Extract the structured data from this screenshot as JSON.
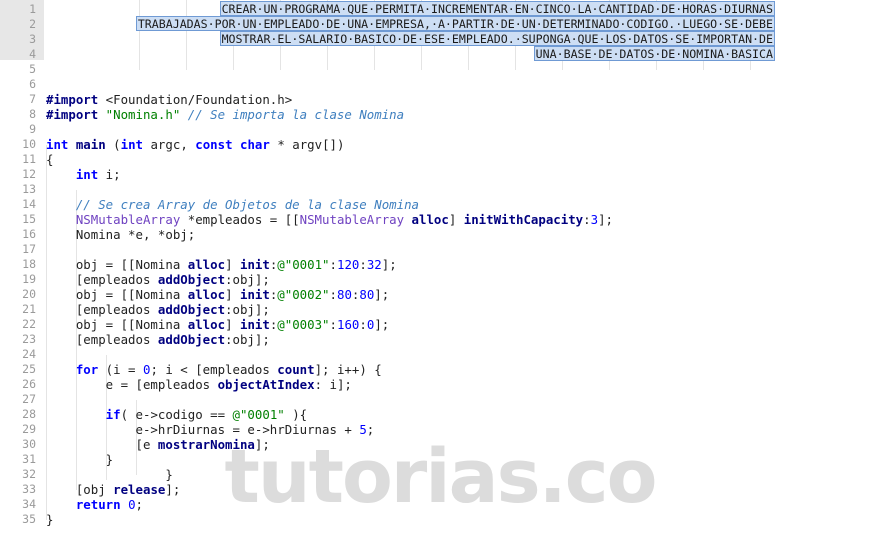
{
  "editor": {
    "language": "Objective-C",
    "watermark": "tutorias.co",
    "gutter_highlight_lines": [
      1,
      2,
      3,
      4
    ],
    "total_lines": 35,
    "colors": {
      "background": "#ffffff",
      "gutter_background": "#e7e7e7",
      "line_number": "#9a9a9a",
      "selection_fill": "#cddef4",
      "selection_border": "#6f9ad4",
      "keyword": "#0000ff",
      "preprocessor": "#000080",
      "string": "#008000",
      "comment": "#3f7fbf",
      "class_name": "#6f42c1",
      "selector": "#000080",
      "number": "#0000ff",
      "watermark": "#dcdcdc",
      "indent_guide": "#e4e4e4"
    }
  },
  "line_numbers": [
    "1",
    "2",
    "3",
    "4",
    "5",
    "6",
    "7",
    "8",
    "9",
    "10",
    "11",
    "12",
    "13",
    "14",
    "15",
    "16",
    "17",
    "18",
    "19",
    "20",
    "21",
    "22",
    "23",
    "24",
    "25",
    "26",
    "27",
    "28",
    "29",
    "30",
    "31",
    "32",
    "33",
    "34",
    "35"
  ],
  "selected_header": {
    "full_text": "CREAR UN PROGRAMA QUE PERMITA INCREMENTAR EN CINCO LA CANTIDAD DE HORAS DIURNAS TRABAJADAS POR UN EMPLEADO DE UNA EMPRESA, A PARTIR DE UN DETERMINADO CODIGO. LUEGO SE DEBE MOSTRAR EL SALARIO BASICO DE ESE EMPLEADO. SUPONGA QUE LOS DATOS SE IMPORTAN DE UNA BASE DE DATOS DE NOMINA BASICA",
    "lines": [
      "CREAR·UN·PROGRAMA·QUE·PERMITA·INCREMENTAR·EN·CINCO·LA·CANTIDAD·DE·HORAS·DIURNAS",
      "TRABAJADAS·POR·UN·EMPLEADO·DE·UNA·EMPRESA,·A·PARTIR·DE·UN·DETERMINADO·CODIGO.·LUEGO·SE·DEBE",
      "MOSTRAR·EL·SALARIO·BASICO·DE·ESE·EMPLEADO.·SUPONGA·QUE·LOS·DATOS·SE·IMPORTAN·DE",
      "UNA·BASE·DE·DATOS·DE·NOMINA·BASICA"
    ]
  },
  "code_lines": {
    "l7": {
      "pre": "#import",
      "rest": " <Foundation/Foundation.h>"
    },
    "l8": {
      "pre": "#import",
      "str": " \"Nomina.h\"",
      "cmt": " // Se importa la clase Nomina"
    },
    "l10": {
      "kw1": "int",
      "fn": " main",
      "p1": " (",
      "kw2": "int",
      "p2": " argc, ",
      "kw3": "const",
      "kw4": " char",
      "p3": " * argv[])"
    },
    "l11": {
      "text": "{"
    },
    "l12": {
      "kw": "    int",
      "text": " i;"
    },
    "l14": {
      "cmt": "    // Se crea Array de Objetos de la clase Nomina"
    },
    "l15": {
      "cls": "    NSMutableArray",
      "p1": " *empleados = [[",
      "cls2": "NSMutableArray",
      "sel1": " alloc",
      "p2": "] ",
      "sel2": "initWithCapacity",
      "p3": ":",
      "num": "3",
      "p4": "];"
    },
    "l16": {
      "text": "    Nomina *e, *obj;"
    },
    "l18": {
      "p1": "    obj = [[Nomina ",
      "sel1": "alloc",
      "p2": "] ",
      "sel2": "init",
      "p3": ":",
      "str": "@\"0001\"",
      "p4": ":",
      "num1": "120",
      "p5": ":",
      "num2": "32",
      "p6": "];"
    },
    "l19": {
      "p1": "    [empleados ",
      "sel": "addObject",
      "p2": ":obj];"
    },
    "l20": {
      "p1": "    obj = [[Nomina ",
      "sel1": "alloc",
      "p2": "] ",
      "sel2": "init",
      "p3": ":",
      "str": "@\"0002\"",
      "p4": ":",
      "num1": "80",
      "p5": ":",
      "num2": "80",
      "p6": "];"
    },
    "l21": {
      "p1": "    [empleados ",
      "sel": "addObject",
      "p2": ":obj];"
    },
    "l22": {
      "p1": "    obj = [[Nomina ",
      "sel1": "alloc",
      "p2": "] ",
      "sel2": "init",
      "p3": ":",
      "str": "@\"0003\"",
      "p4": ":",
      "num1": "160",
      "p5": ":",
      "num2": "0",
      "p6": "];"
    },
    "l23": {
      "p1": "    [empleados ",
      "sel": "addObject",
      "p2": ":obj];"
    },
    "l25": {
      "kw": "    for",
      "p1": " (i = ",
      "num": "0",
      "p2": "; i < [empleados ",
      "sel": "count",
      "p3": "]; i++) {"
    },
    "l26": {
      "p1": "        e = [empleados ",
      "sel": "objectAtIndex",
      "p2": ": i];"
    },
    "l28": {
      "kw": "        if",
      "p1": "( e->codigo == ",
      "str": "@\"0001\"",
      "p2": " ){"
    },
    "l29": {
      "p1": "            e->hrDiurnas = e->hrDiurnas + ",
      "num": "5",
      "p2": ";"
    },
    "l30": {
      "p1": "            [e ",
      "sel": "mostrarNomina",
      "p2": "];"
    },
    "l31": {
      "text": "        }"
    },
    "l32": {
      "text": "                }"
    },
    "l33": {
      "p1": "    [obj ",
      "sel": "release",
      "p2": "];"
    },
    "l34": {
      "kw": "    return",
      "num": " 0",
      "p1": ";"
    },
    "l35": {
      "text": "}"
    }
  }
}
